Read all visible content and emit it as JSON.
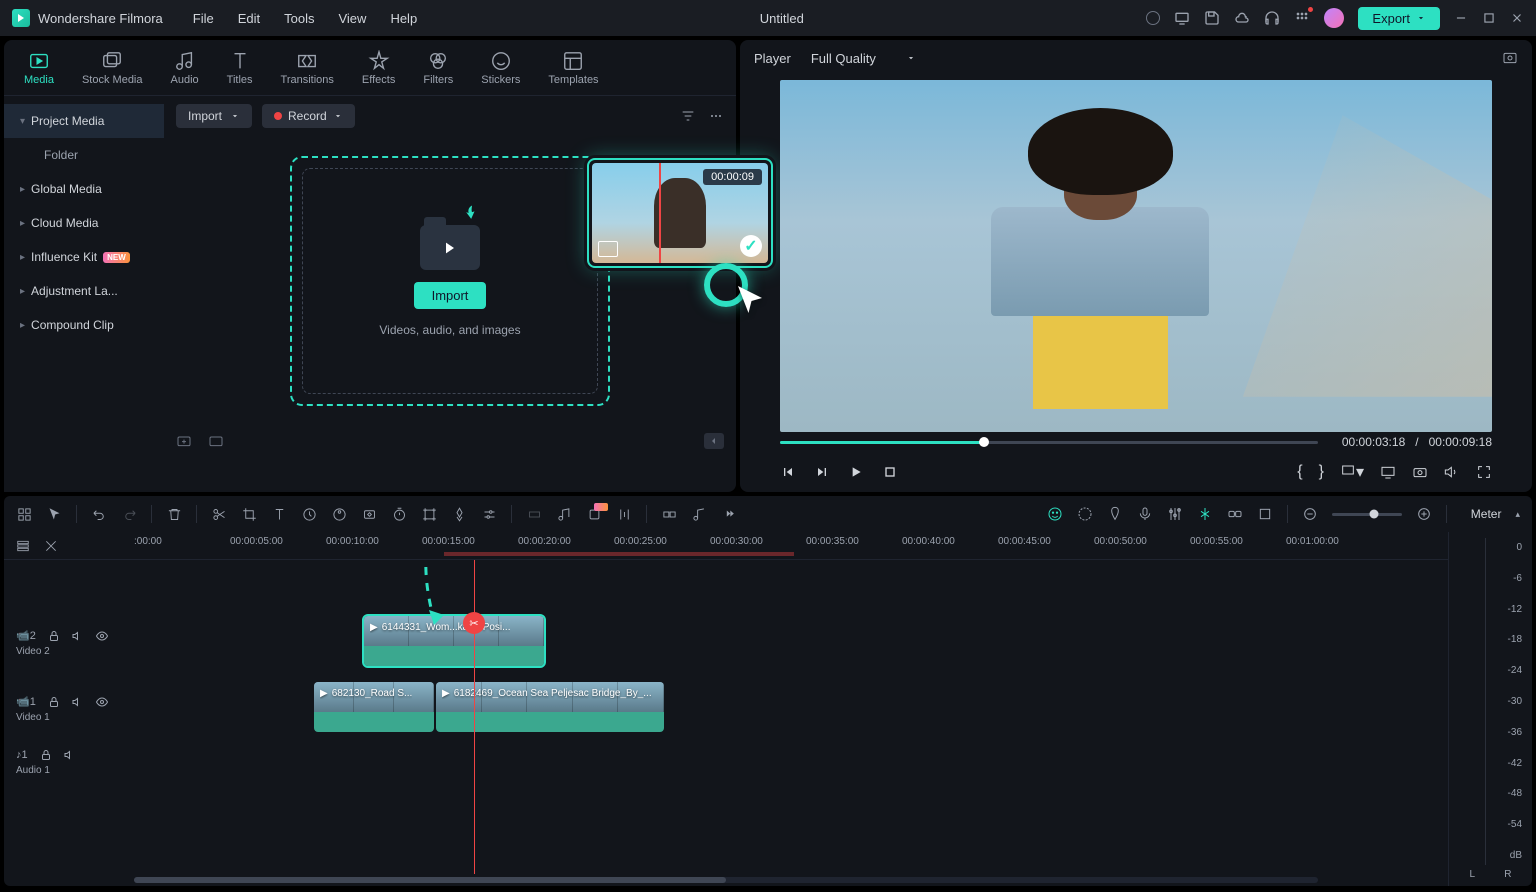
{
  "app": {
    "name": "Wondershare Filmora",
    "document": "Untitled"
  },
  "menu": [
    "File",
    "Edit",
    "Tools",
    "View",
    "Help"
  ],
  "export_label": "Export",
  "tabs": [
    {
      "label": "Media"
    },
    {
      "label": "Stock Media"
    },
    {
      "label": "Audio"
    },
    {
      "label": "Titles"
    },
    {
      "label": "Transitions"
    },
    {
      "label": "Effects"
    },
    {
      "label": "Filters"
    },
    {
      "label": "Stickers"
    },
    {
      "label": "Templates"
    }
  ],
  "sidebar": {
    "items": [
      {
        "label": "Project Media",
        "active": true
      },
      {
        "label": "Folder",
        "sub": true
      },
      {
        "label": "Global Media"
      },
      {
        "label": "Cloud Media"
      },
      {
        "label": "Influence Kit",
        "new": true
      },
      {
        "label": "Adjustment La..."
      },
      {
        "label": "Compound Clip"
      }
    ]
  },
  "import": {
    "btn": "Import",
    "hint": "Videos, audio, and images",
    "dropdown": "Import",
    "record": "Record"
  },
  "thumb": {
    "time": "00:00:09"
  },
  "player": {
    "label": "Player",
    "quality": "Full Quality",
    "current": "00:00:03:18",
    "total": "00:00:09:18",
    "sep": "/"
  },
  "ruler": [
    ":00:00",
    "00:00:05:00",
    "00:00:10:00",
    "00:00:15:00",
    "00:00:20:00",
    "00:00:25:00",
    "00:00:30:00",
    "00:00:35:00",
    "00:00:40:00",
    "00:00:45:00",
    "00:00:50:00",
    "00:00:55:00",
    "00:01:00:00"
  ],
  "tracks": {
    "video2": {
      "label": "Video 2",
      "clip": "6144331_Wom...kater Posi..."
    },
    "video1": {
      "label": "Video 1",
      "clip1": "682130_Road S...",
      "clip2": "6182469_Ocean Sea Peljesac Bridge_By_..."
    },
    "audio1": {
      "label": "Audio 1"
    }
  },
  "meter": {
    "label": "Meter",
    "scale": [
      "0",
      "-6",
      "-12",
      "-18",
      "-24",
      "-30",
      "-36",
      "-42",
      "-48",
      "-54"
    ],
    "unit": "dB",
    "L": "L",
    "R": "R"
  }
}
